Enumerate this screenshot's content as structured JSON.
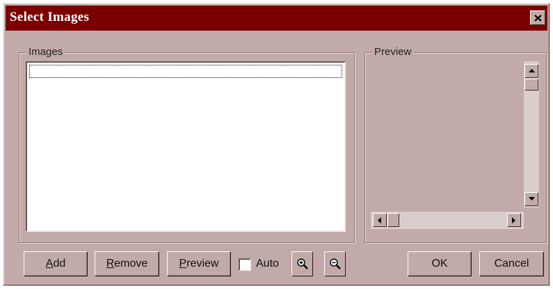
{
  "window": {
    "title": "Select Images"
  },
  "images_group": {
    "label": "Images"
  },
  "preview_group": {
    "label": "Preview"
  },
  "buttons": {
    "add_prefix": "A",
    "add_rest": "dd",
    "remove_prefix": "R",
    "remove_rest": "emove",
    "preview_prefix": "P",
    "preview_rest": "review",
    "ok": "OK",
    "cancel": "Cancel"
  },
  "auto_checkbox": {
    "label": "Auto",
    "checked": false
  },
  "icons": {
    "close": "close-icon",
    "zoom_in": "zoom-in-icon",
    "zoom_out": "zoom-out-icon",
    "scroll_up": "arrow-up-icon",
    "scroll_down": "arrow-down-icon",
    "scroll_left": "arrow-left-icon",
    "scroll_right": "arrow-right-icon"
  },
  "colors": {
    "titlebar": "#7a0000",
    "face": "#c2aaa8"
  }
}
